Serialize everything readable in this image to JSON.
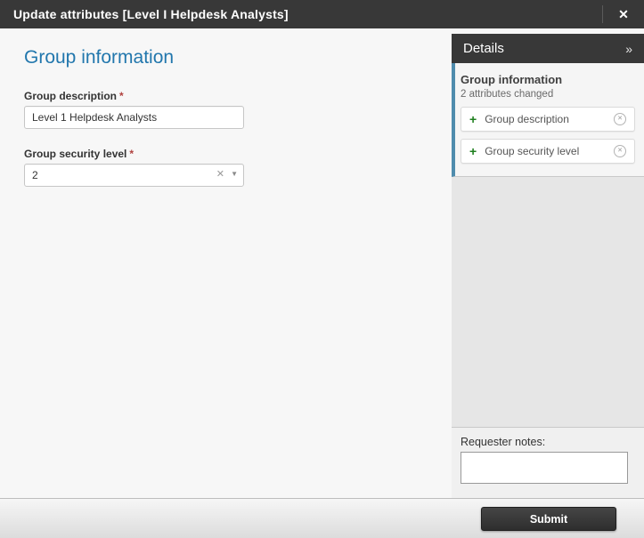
{
  "titlebar": {
    "title": "Update attributes [Level I Helpdesk Analysts]",
    "close_icon": "✕"
  },
  "main": {
    "heading": "Group information",
    "fields": [
      {
        "label": "Group description",
        "required_marker": "*",
        "value": "Level 1 Helpdesk Analysts",
        "type": "text"
      },
      {
        "label": "Group security level",
        "required_marker": "*",
        "value": "2",
        "type": "combo",
        "clear_icon": "✕",
        "dropdown_icon": "▼"
      }
    ]
  },
  "sidebar": {
    "header": {
      "title": "Details",
      "collapse_icon": "»"
    },
    "panel": {
      "title": "Group information",
      "subtitle": "2 attributes changed",
      "items": [
        {
          "label": "Group description",
          "add_icon": "+",
          "remove_icon": "✕"
        },
        {
          "label": "Group security level",
          "add_icon": "+",
          "remove_icon": "✕"
        }
      ]
    },
    "requester_notes": {
      "label": "Requester notes:",
      "value": ""
    }
  },
  "footer": {
    "submit_label": "Submit"
  },
  "colors": {
    "titlebar_bg": "#383838",
    "heading_blue": "#2277ad",
    "panel_accent_blue": "#4f8cad",
    "add_green": "#1e7e1e",
    "required_red": "#b0413e"
  }
}
